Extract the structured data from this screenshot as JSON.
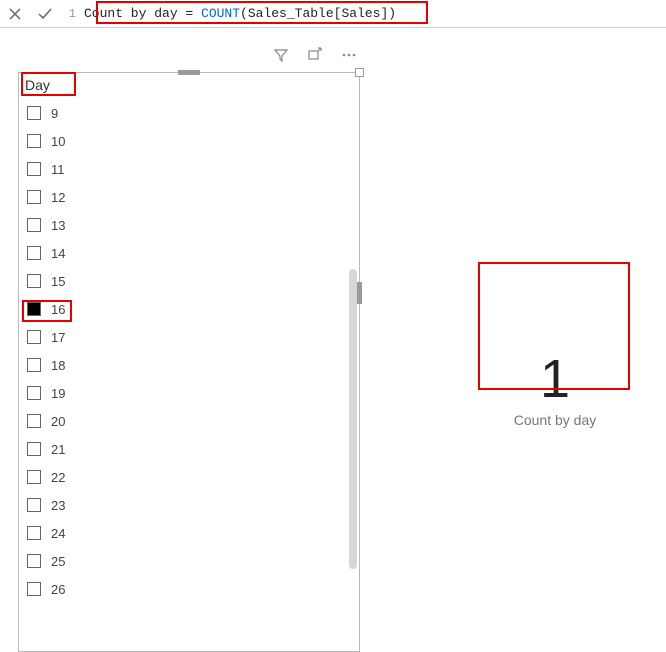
{
  "formula_bar": {
    "line_number": "1",
    "measure_name": "Count by day",
    "equals": " = ",
    "func": "COUNT",
    "args": "(Sales_Table[Sales])"
  },
  "toolbar": {
    "filter_icon": "filter-icon",
    "focus_icon": "focus-mode-icon",
    "more_icon": "more-options-icon"
  },
  "slicer": {
    "header": "Day",
    "items": [
      {
        "label": "9",
        "checked": false
      },
      {
        "label": "10",
        "checked": false
      },
      {
        "label": "11",
        "checked": false
      },
      {
        "label": "12",
        "checked": false
      },
      {
        "label": "13",
        "checked": false
      },
      {
        "label": "14",
        "checked": false
      },
      {
        "label": "15",
        "checked": false
      },
      {
        "label": "16",
        "checked": true
      },
      {
        "label": "17",
        "checked": false
      },
      {
        "label": "18",
        "checked": false
      },
      {
        "label": "19",
        "checked": false
      },
      {
        "label": "20",
        "checked": false
      },
      {
        "label": "21",
        "checked": false
      },
      {
        "label": "22",
        "checked": false
      },
      {
        "label": "23",
        "checked": false
      },
      {
        "label": "24",
        "checked": false
      },
      {
        "label": "25",
        "checked": false
      },
      {
        "label": "26",
        "checked": false
      }
    ]
  },
  "card": {
    "value": "1",
    "label": "Count by day"
  }
}
